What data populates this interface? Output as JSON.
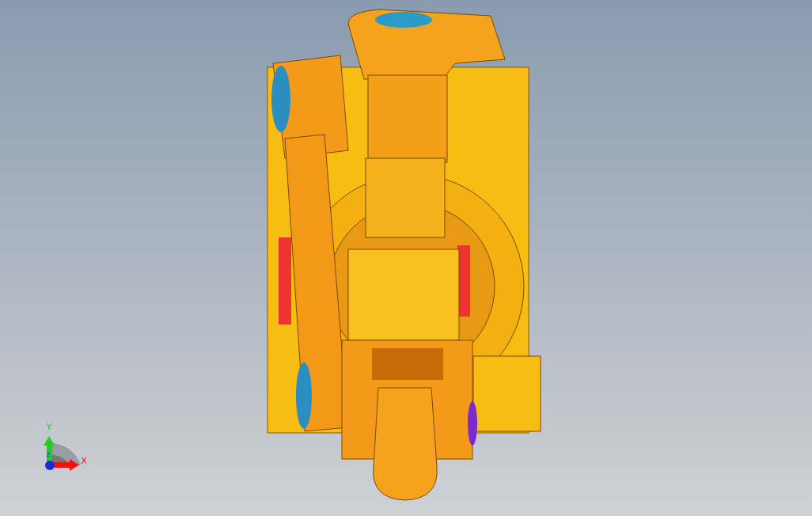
{
  "viewport": {
    "triad": {
      "axes": [
        {
          "kind": "y",
          "label": "Y"
        },
        {
          "kind": "z",
          "label": "Z"
        },
        {
          "kind": "x",
          "label": "X"
        }
      ]
    }
  }
}
